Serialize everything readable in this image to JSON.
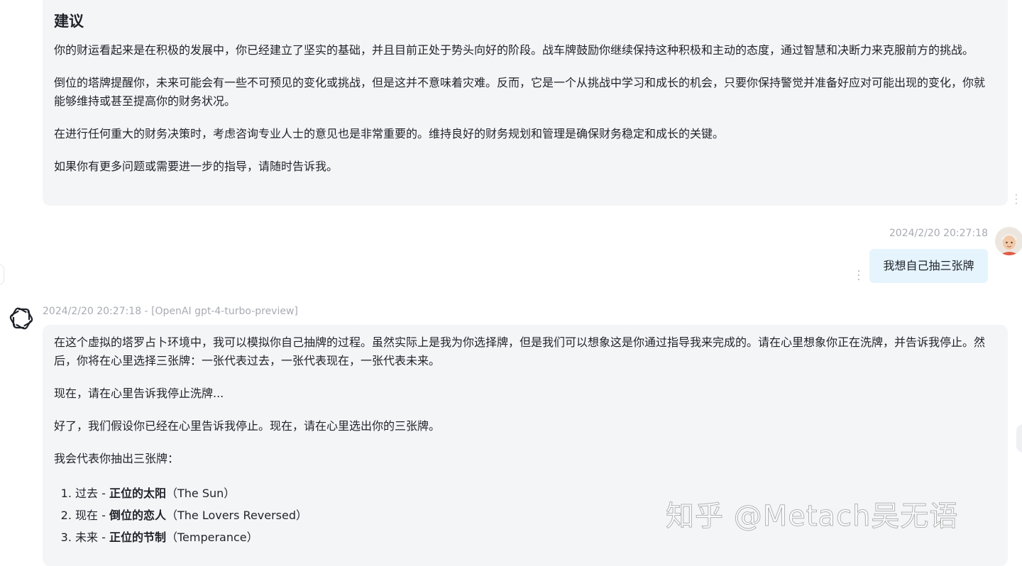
{
  "top_message": {
    "heading": "建议",
    "paragraphs": [
      "你的财运看起来是在积极的发展中，你已经建立了坚实的基础，并且目前正处于势头向好的阶段。战车牌鼓励你继续保持这种积极和主动的态度，通过智慧和决断力来克服前方的挑战。",
      "倒位的塔牌提醒你，未来可能会有一些不可预见的变化或挑战，但是这并不意味着灾难。反而，它是一个从挑战中学习和成长的机会，只要你保持警觉并准备好应对可能出现的变化，你就能够维持或甚至提高你的财务状况。",
      "在进行任何重大的财务决策时，考虑咨询专业人士的意见也是非常重要的。维持良好的财务规划和管理是确保财务稳定和成长的关键。",
      "如果你有更多问题或需要进一步的指导，请随时告诉我。"
    ]
  },
  "user_message": {
    "timestamp": "2024/2/20 20:27:18",
    "text": "我想自己抽三张牌",
    "avatar_icon": "user-avatar-icon"
  },
  "bot_message": {
    "meta": "2024/2/20 20:27:18 - [OpenAI gpt-4-turbo-preview]",
    "avatar_icon": "openai-logo-icon",
    "paragraphs": [
      "在这个虚拟的塔罗占卜环境中，我可以模拟你自己抽牌的过程。虽然实际上是我为你选择牌，但是我们可以想象这是你通过指导我来完成的。请在心里想象你正在洗牌，并告诉我停止。然后，你将在心里选择三张牌：一张代表过去，一张代表现在，一张代表未来。",
      "现在，请在心里告诉我停止洗牌...",
      "好了，我们假设你已经在心里告诉我停止。现在，请在心里选出你的三张牌。",
      "我会代表你抽出三张牌："
    ],
    "cards": [
      {
        "position": "过去 - ",
        "card": "正位的太阳",
        "english": "（The Sun）"
      },
      {
        "position": "现在 - ",
        "card": "倒位的恋人",
        "english": "（The Lovers Reversed）"
      },
      {
        "position": "未来 - ",
        "card": "正位的节制",
        "english": "（Temperance）"
      }
    ]
  },
  "watermark": "知乎 @Metach吴无语",
  "colors": {
    "bubble_bg": "#f4f5f7",
    "user_bubble_bg": "#e6f4fd",
    "meta_text": "#a8abb2",
    "body_text": "#1f2329"
  }
}
